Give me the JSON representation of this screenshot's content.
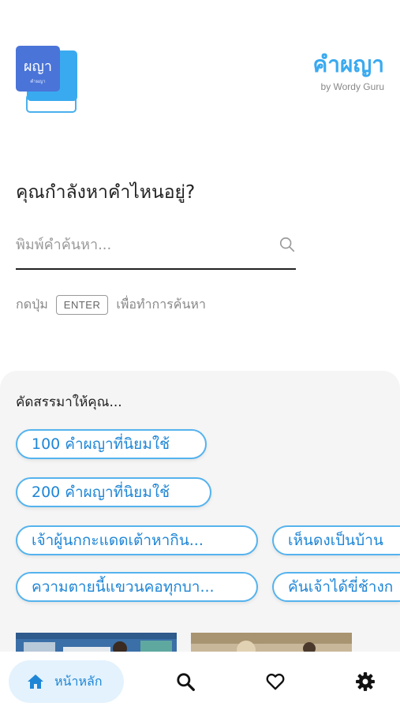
{
  "header": {
    "logo_text": "ผญา",
    "logo_subtext": "คำผญา",
    "title": "คำผญา",
    "subtitle": "by Wordy Guru"
  },
  "search": {
    "question": "คุณกำลังหาคำไหนอยู่?",
    "placeholder": "พิมพ์คำค้นหา...",
    "value": "",
    "hint_before": "กดปุ่ม",
    "hint_key": "ENTER",
    "hint_after": "เพื่อทำการค้นหา"
  },
  "recommend": {
    "title": "คัดสรรมาให้คุณ...",
    "chips": [
      "100 คำผญาที่นิยมใช้",
      "200 คำผญาที่นิยมใช้",
      "เจ้าผู้นกกะแดดเต้าหากิน...",
      "เห็นดงเป็นบ้าน",
      "ความตายนี้แขวนคอทุกบา...",
      "คันเจ้าได้ขี่ช้างก"
    ]
  },
  "bottom_nav": {
    "home_label": "หน้าหลัก",
    "active": "home"
  },
  "colors": {
    "accent": "#3aaaf0",
    "chip_border": "#55b3ee",
    "chip_text": "#1f86d6",
    "active_nav_bg": "#e3f2fd",
    "panel_bg": "#f5f5f5"
  },
  "icons": [
    "book-logo-icon",
    "search-icon",
    "home-icon",
    "heart-icon",
    "gear-icon"
  ]
}
